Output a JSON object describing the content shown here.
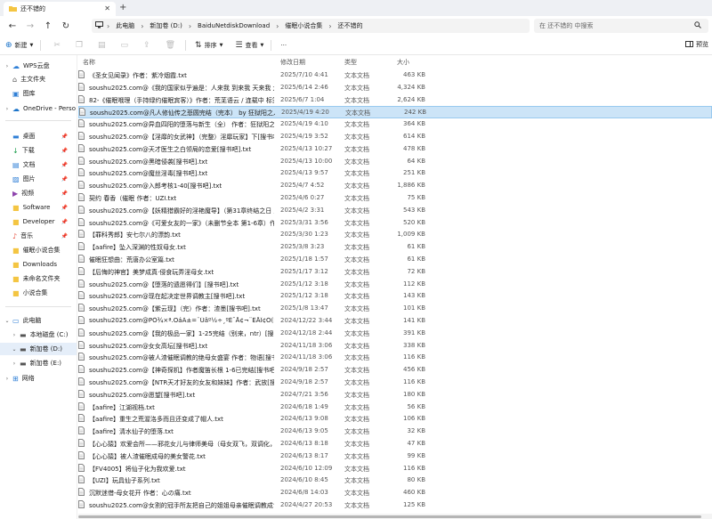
{
  "window": {
    "tab_title": "还不错的",
    "tab_close": "✕",
    "new_tab": "+"
  },
  "nav": {
    "back": "←",
    "forward": "→",
    "up": "↑",
    "refresh": "↻"
  },
  "breadcrumb": [
    "此电脑",
    "新加卷 (D:)",
    "BaiduNetdiskDownload",
    "催眠小说合集",
    "还不错的"
  ],
  "search": {
    "placeholder": "在 还不错的 中搜索"
  },
  "toolbar": {
    "new_label": "新建",
    "sort_label": "排序",
    "view_label": "查看",
    "more_label": "···",
    "preview_label": "预览"
  },
  "sidebar": {
    "items": [
      {
        "label": "WPS云盘",
        "icon": "cloud-icon"
      },
      {
        "label": "主文件夹",
        "icon": "home-icon"
      },
      {
        "label": "图库",
        "icon": "gallery-icon"
      },
      {
        "label": "OneDrive - Perso",
        "icon": "onedrive-icon"
      },
      {
        "label": "桌面",
        "icon": "desktop-icon"
      },
      {
        "label": "下载",
        "icon": "download-icon"
      },
      {
        "label": "文档",
        "icon": "document-icon"
      },
      {
        "label": "图片",
        "icon": "picture-icon"
      },
      {
        "label": "视频",
        "icon": "video-icon"
      },
      {
        "label": "Software",
        "icon": "folder-icon"
      },
      {
        "label": "Developer",
        "icon": "folder-icon"
      },
      {
        "label": "音乐",
        "icon": "music-icon"
      },
      {
        "label": "催眠小说合集",
        "icon": "folder-icon"
      },
      {
        "label": "Downloads",
        "icon": "folder-icon"
      },
      {
        "label": "未命名文件夹",
        "icon": "folder-icon"
      },
      {
        "label": "小说合集",
        "icon": "folder-icon"
      },
      {
        "label": "此电脑",
        "icon": "pc-icon"
      },
      {
        "label": "本地磁盘 (C:)",
        "icon": "drive-icon"
      },
      {
        "label": "新加卷 (D:)",
        "icon": "drive-icon"
      },
      {
        "label": "新加卷 (E:)",
        "icon": "drive-icon"
      },
      {
        "label": "网络",
        "icon": "network-icon"
      }
    ]
  },
  "columns": {
    "name": "名称",
    "date": "修改日期",
    "type": "类型",
    "size": "大小"
  },
  "files": [
    {
      "name": "《圣女见闻录》作者：紫冷烟霞.txt",
      "date": "2025/7/10 4:41",
      "type": "文本文档",
      "size": "463 KB"
    },
    {
      "name": "soushu2025.com@《我的国家似乎遍是：人来我 到来我 天来我 太元圣女…",
      "date": "2025/6/14 2:46",
      "type": "文本文档",
      "size": "4,324 KB"
    },
    {
      "name": "82-《催眠哦理（手持绿约催眠宾客）》作者：荒芜语云 / 连载中 标签：#性转…",
      "date": "2025/6/7 1:04",
      "type": "文本文档",
      "size": "2,624 KB"
    },
    {
      "name": "soushu2025.com@凡人修仙传之悲圆完结（完本） by 狂狱阳之人[搜书吧].txt",
      "date": "2025/4/19 4:20",
      "type": "文本文档",
      "size": "242 KB"
    },
    {
      "name": "soushu2025.com@异血四阳的堕落与新生（全） 作者：狂狱阳之人[搜书吧].txt",
      "date": "2025/4/19 4:10",
      "type": "文本文档",
      "size": "364 KB"
    },
    {
      "name": "soushu2025.com@【淫靡的女武神】（完整）淫靡玩家】下[搜书吧].txt",
      "date": "2025/4/19 3:52",
      "type": "文本文档",
      "size": "614 KB"
    },
    {
      "name": "soushu2025.com@天才医生之白领局的恋爱[搜书吧].txt",
      "date": "2025/4/13 10:27",
      "type": "文本文档",
      "size": "478 KB"
    },
    {
      "name": "soushu2025.com@黑暗侵袭[搜书吧].txt",
      "date": "2025/4/13 10:00",
      "type": "文本文档",
      "size": "64 KB"
    },
    {
      "name": "soushu2025.com@魔丝淫毒[搜书吧].txt",
      "date": "2025/4/13 9:57",
      "type": "文本文档",
      "size": "251 KB"
    },
    {
      "name": "soushu2025.com@入郎考核1-40[搜书吧].txt",
      "date": "2025/4/7 4:52",
      "type": "文本文档",
      "size": "1,886 KB"
    },
    {
      "name": "契约 春香（催眠 作者：UZI.txt",
      "date": "2025/4/6 0:27",
      "type": "文本文档",
      "size": "75 KB"
    },
    {
      "name": "soushu2025.com@【妖精猎霸好的淫艳魔导】（第31章终结之日 后记尚未…",
      "date": "2025/4/2 3:31",
      "type": "文本文档",
      "size": "543 KB"
    },
    {
      "name": "soushu2025.com@《可爱女友的一家》（未删节全本 第1-6章）作者：drag…",
      "date": "2025/3/31 3:56",
      "type": "文本文档",
      "size": "520 KB"
    },
    {
      "name": "【罪科秀郎】安七尔八的漂韵.txt",
      "date": "2025/3/30 1:23",
      "type": "文本文档",
      "size": "1,009 KB"
    },
    {
      "name": "【aafire】坠入深渊的性奴母女.txt",
      "date": "2025/3/8 3:23",
      "type": "文本文档",
      "size": "61 KB"
    },
    {
      "name": "催眠狂想曲：荒唐办公室篇.txt",
      "date": "2025/1/18 1:57",
      "type": "文本文档",
      "size": "61 KB"
    },
    {
      "name": "【后悔的神官】美梦成真·侵食玩弄淫母女.txt",
      "date": "2025/1/17 3:12",
      "type": "文本文档",
      "size": "72 KB"
    },
    {
      "name": "soushu2025.com@【堕落的遗愿得们】[搜书吧].txt",
      "date": "2025/1/12 3:18",
      "type": "文本文档",
      "size": "112 KB"
    },
    {
      "name": "soushu2025.com@现在起决定世界调教主[搜书吧].txt",
      "date": "2025/1/12 3:18",
      "type": "文本文档",
      "size": "143 KB"
    },
    {
      "name": "soushu2025.com@【紫云现】（完）作者：渣墨[搜书吧].txt",
      "date": "2025/1/8 13:47",
      "type": "文本文档",
      "size": "101 KB"
    },
    {
      "name": "soushu2025.com@PÔ¾×ª.OáÄ±=¨Üâº½÷¸ºÊ¯Å¢¬¨ÊÅÎ¢Ò(ÉÑÊë°É].txt",
      "date": "2024/12/22 3:44",
      "type": "文本文档",
      "size": "141 KB"
    },
    {
      "name": "soushu2025.com@【我的极品一家】1-25完结（别来，ntr）[搜书吧].txt",
      "date": "2024/12/18 2:44",
      "type": "文本文档",
      "size": "391 KB"
    },
    {
      "name": "soushu2025.com@女女高坛[搜书吧].txt",
      "date": "2024/11/18 3:06",
      "type": "文本文档",
      "size": "338 KB"
    },
    {
      "name": "soushu2025.com@被人渣催眠调教的绝母女盛宴 作者：物语[搜书吧].txt",
      "date": "2024/11/18 3:06",
      "type": "文本文档",
      "size": "116 KB"
    },
    {
      "name": "soushu2025.com@【神奇探机】作者魔笛长根 1-6已完结[搜书吧].txt",
      "date": "2024/9/18 2:57",
      "type": "文本文档",
      "size": "456 KB"
    },
    {
      "name": "soushu2025.com@【NTR天才好友的女友和妹妹】作者：武放[搜书吧].txt",
      "date": "2024/9/18 2:57",
      "type": "文本文档",
      "size": "116 KB"
    },
    {
      "name": "soushu2025.com@愿望[搜书吧].txt",
      "date": "2024/7/21 3:56",
      "type": "文本文档",
      "size": "180 KB"
    },
    {
      "name": "【aafire】江湖视档.txt",
      "date": "2024/6/18 1:49",
      "type": "文本文档",
      "size": "56 KB"
    },
    {
      "name": "【aafire】重生之荒渥洛多而且还变成了帽人.txt",
      "date": "2024/6/13 9:08",
      "type": "文本文档",
      "size": "106 KB"
    },
    {
      "name": "【aafire】清水仙子的堕落.txt",
      "date": "2024/6/13 9:05",
      "type": "文本文档",
      "size": "32 KB"
    },
    {
      "name": "【心心猿】欢爱会所——邪花女儿与律师美母（母女双飞，双调化，淫遭置…",
      "date": "2024/6/13 8:18",
      "type": "文本文档",
      "size": "47 KB"
    },
    {
      "name": "【心心猿】被人渣催眠成母的美女警花.txt",
      "date": "2024/6/13 8:17",
      "type": "文本文档",
      "size": "99 KB"
    },
    {
      "name": "【FV4005】将仙子化为我欢爱.txt",
      "date": "2024/6/10 12:09",
      "type": "文本文档",
      "size": "116 KB"
    },
    {
      "name": "【UZI】玩具仙子系列.txt",
      "date": "2024/6/10 8:45",
      "type": "文本文档",
      "size": "80 KB"
    },
    {
      "name": "沉默迷借-母女花开 作者：心の痛.txt",
      "date": "2024/6/8 14:03",
      "type": "文本文档",
      "size": "460 KB"
    },
    {
      "name": "soushu2025.com@女割的冠手所友把自己的姐姐母亲催眠调教成专属母狗。…",
      "date": "2024/4/27 20:53",
      "type": "文本文档",
      "size": "125 KB"
    }
  ]
}
